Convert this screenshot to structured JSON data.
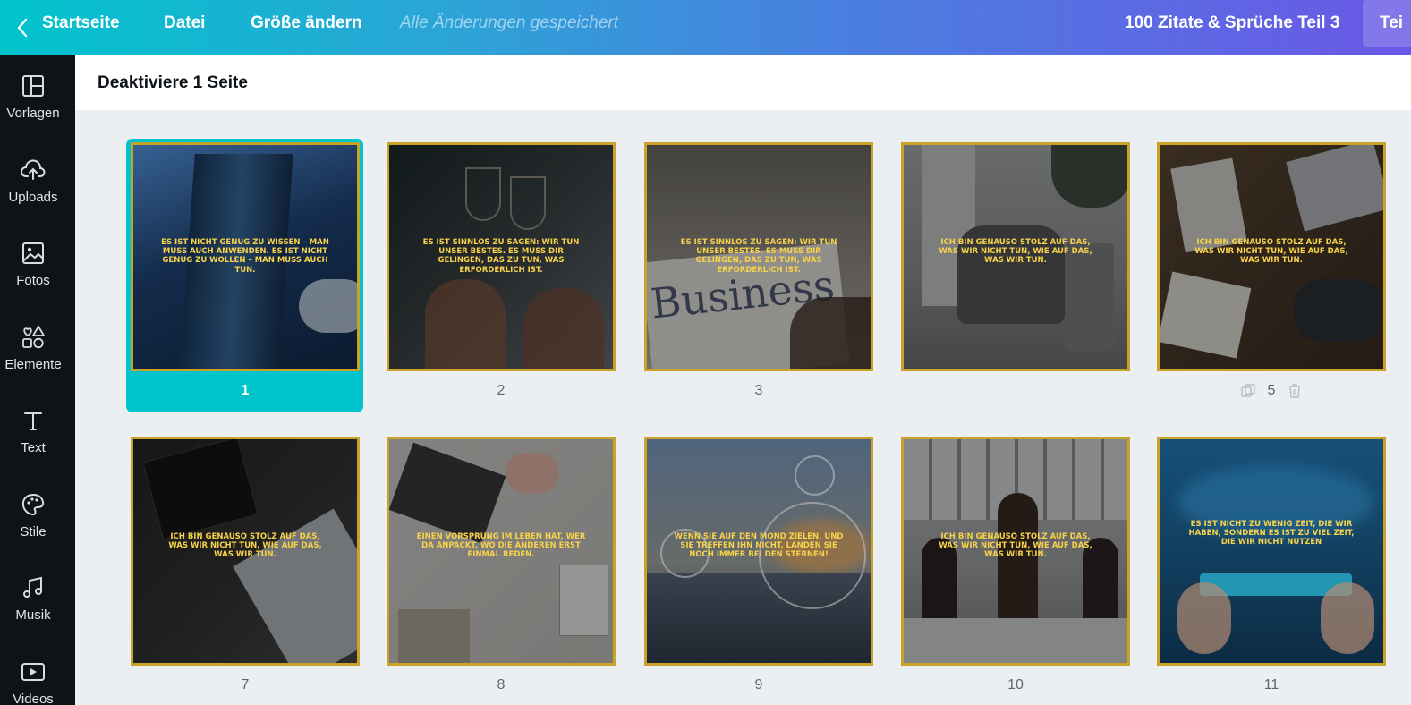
{
  "topbar": {
    "home_label": "Startseite",
    "file_label": "Datei",
    "resize_label": "Größe ändern",
    "saved_status": "Alle Änderungen gespeichert",
    "design_title": "100 Zitate & Sprüche Teil 3",
    "share_label": "Tei"
  },
  "sidebar": {
    "items": [
      {
        "label": "Vorlagen",
        "icon": "layout-icon"
      },
      {
        "label": "Uploads",
        "icon": "cloud-upload-icon"
      },
      {
        "label": "Fotos",
        "icon": "image-icon"
      },
      {
        "label": "Elemente",
        "icon": "shapes-icon"
      },
      {
        "label": "Text",
        "icon": "text-icon"
      },
      {
        "label": "Stile",
        "icon": "palette-icon"
      },
      {
        "label": "Musik",
        "icon": "music-icon"
      },
      {
        "label": "Videos",
        "icon": "video-icon"
      }
    ]
  },
  "subheader": {
    "title": "Deaktiviere 1 Seite"
  },
  "pages": [
    {
      "number": "1",
      "quote": "Es ist nicht genug zu wissen – man muss auch anwenden. Es ist nicht genug zu wollen – man muss auch tun.",
      "selected": true,
      "bg": "#2c4a6e"
    },
    {
      "number": "2",
      "quote": "Es ist sinnlos zu sagen: Wir tun unser Bestes. Es muss dir gelingen, das zu tun, was erforderlich ist.",
      "selected": false,
      "bg": "#3a3a3e"
    },
    {
      "number": "3",
      "quote": "Es ist sinnlos zu sagen: Wir tun unser Bestes. Es muss dir gelingen, das zu tun, was erforderlich ist.",
      "selected": false,
      "bg": "#54524f"
    },
    {
      "number": "",
      "quote": "Ich bin genauso stolz auf das, was wir nicht tun, wie auf das, was wir tun.",
      "selected": false,
      "bg": "#4e5153"
    },
    {
      "number": "5",
      "quote": "Ich bin genauso stolz auf das, was wir nicht tun, wie auf das, was wir tun.",
      "selected": false,
      "bg": "#4a3f33"
    },
    {
      "number": "7",
      "quote": "Ich bin genauso stolz auf das, was wir nicht tun, wie auf das, was wir tun.",
      "selected": false,
      "bg": "#2a2a2a"
    },
    {
      "number": "8",
      "quote": "Einen Vorsprung im Leben hat, wer da anpackt, wo die anderen erst einmal reden.",
      "selected": false,
      "bg": "#8c8a88"
    },
    {
      "number": "9",
      "quote": "Wenn Sie auf den Mond zielen, und Sie treffen ihn nicht, landen Sie noch immer bei den Sternen!",
      "selected": false,
      "bg": "#3d4f68"
    },
    {
      "number": "10",
      "quote": "Ich bin genauso stolz auf das, was wir nicht tun, wie auf das, was wir tun.",
      "selected": false,
      "bg": "#5a5856"
    },
    {
      "number": "11",
      "quote": "Es ist nicht zu wenig Zeit, die wir haben, sondern es ist zu viel Zeit, die wir nicht nutzen",
      "selected": false,
      "bg": "#1c5a8a"
    }
  ],
  "colors": {
    "accent": "#00c4cc",
    "border_gold": "#c9a227",
    "quote_text": "#f7d24a",
    "sidebar_bg": "#0e1318"
  }
}
